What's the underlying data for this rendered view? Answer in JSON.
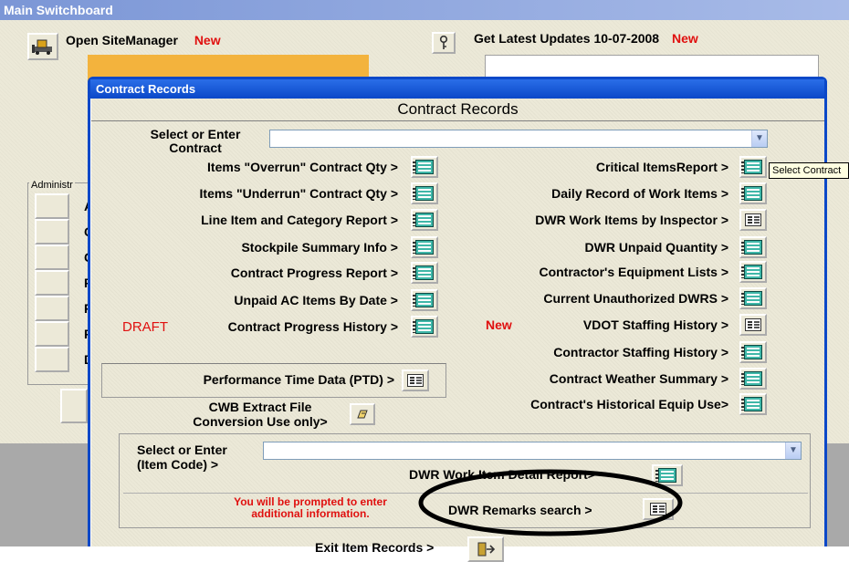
{
  "main": {
    "title": "Main Switchboard",
    "open_site_manager": "Open SiteManager",
    "new_badge": "New",
    "get_updates": "Get Latest Updates 10-07-2008",
    "updates_new": "New",
    "admin_group_label": "Administr",
    "admin_letters": [
      "A",
      "C",
      "C",
      "F",
      "F",
      "F",
      "D"
    ]
  },
  "dialog": {
    "window_title": "Contract Records",
    "form_title": "Contract Records",
    "select_contract_label": "Select or Enter\nContract",
    "left_items": [
      "Items \"Overrun\" Contract Qty >",
      "Items \"Underrun\" Contract Qty >",
      "Line Item and Category Report >",
      "Stockpile Summary Info >",
      "Contract Progress Report >",
      "Unpaid AC Items By Date >",
      "Contract Progress History >"
    ],
    "draft_badge": "DRAFT",
    "ptd_label": "Performance Time Data (PTD) >",
    "cwb_label_line1": "CWB Extract File",
    "cwb_label_line2": "Conversion Use only>",
    "right_items": [
      "Critical ItemsReport >",
      "Daily Record of Work Items >",
      "DWR Work Items by Inspector >",
      "DWR Unpaid Quantity >",
      "Contractor's Equipment Lists >",
      "Current Unauthorized DWRS >",
      "VDOT Staffing History >",
      "Contractor Staffing History >",
      "Contract Weather Summary >",
      "Contract's Historical Equip Use>"
    ],
    "vdot_new_badge": "New",
    "tooltip": "Select Contract",
    "item_code_label_line1": "Select or Enter",
    "item_code_label_line2": "(Item Code) >",
    "dwr_detail_label": "DWR Work Item Detail Report>",
    "prompt_line1": "You will be prompted to enter",
    "prompt_line2": "additional information.",
    "dwr_remarks_label": "DWR Remarks search >",
    "exit_label": "Exit Item Records >"
  },
  "colors": {
    "accent_blue": "#0b48c8",
    "new_red": "#e0100f",
    "form_bg": "#ece9d8",
    "report_icon_teal": "#3fb7a8"
  },
  "icons": {
    "report": "report-list-icon",
    "form": "form-icon",
    "key": "key-icon",
    "bulldozer": "bulldozer-icon",
    "extract": "extract-icon",
    "exit": "exit-door-icon"
  }
}
